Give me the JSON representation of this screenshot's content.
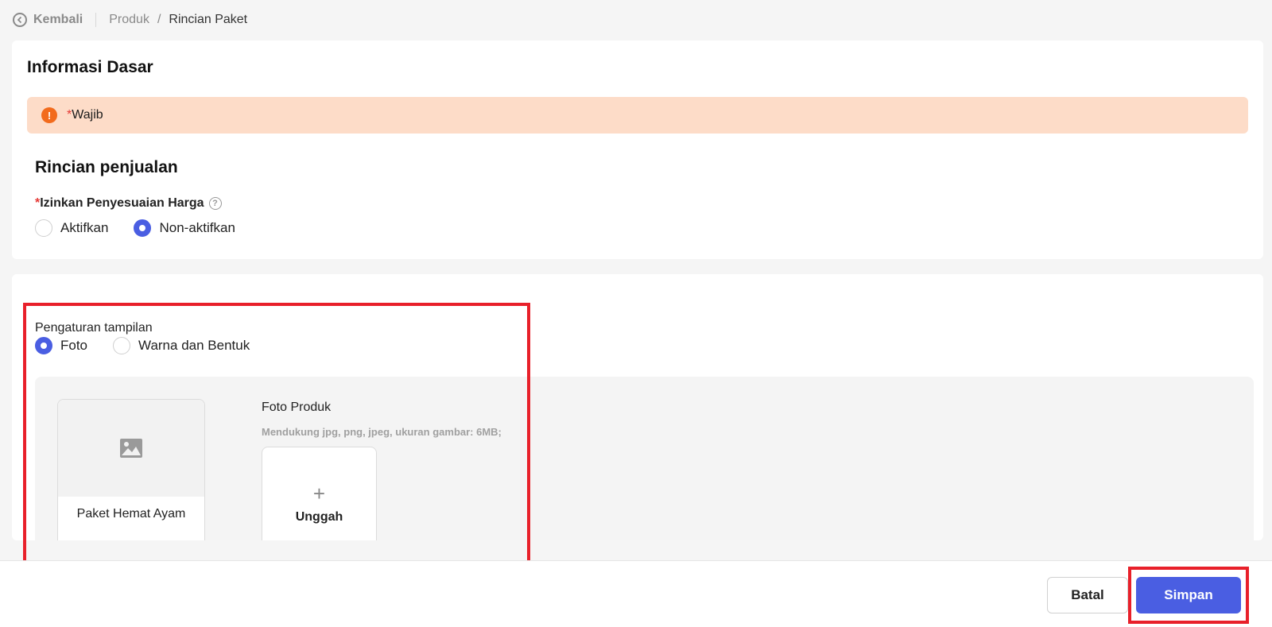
{
  "breadcrumb": {
    "back_label": "Kembali",
    "parent": "Produk",
    "separator": "/",
    "current": "Rincian Paket"
  },
  "basic_info": {
    "title": "Informasi Dasar",
    "alert_required_mark": "*",
    "alert_text": "Wajib"
  },
  "sales_details": {
    "title": "Rincian penjualan",
    "price_adjust_required_mark": "*",
    "price_adjust_label": "Izinkan Penyesuaian Harga",
    "help_glyph": "?",
    "options": [
      "Aktifkan",
      "Non-aktifkan"
    ],
    "selected": "Non-aktifkan"
  },
  "display_settings": {
    "label": "Pengaturan tampilan",
    "options": [
      "Foto",
      "Warna dan Bentuk"
    ],
    "selected": "Foto",
    "preview_name": "Paket Hemat Ayam",
    "photo_title": "Foto Produk",
    "photo_hint": "Mendukung jpg, png, jpeg, ukuran gambar: 6MB;",
    "upload_plus": "+",
    "upload_label": "Unggah"
  },
  "footer": {
    "cancel_label": "Batal",
    "save_label": "Simpan"
  },
  "colors": {
    "accent": "#4a5ee2",
    "alert_bg": "#fddcc8",
    "alert_icon": "#f26b1d",
    "highlight": "#e8202a"
  },
  "icons": {
    "back": "chevron-left-circle-icon",
    "alert": "info-icon",
    "help": "question-circle-icon",
    "preview": "image-placeholder-icon",
    "upload": "plus-icon"
  }
}
